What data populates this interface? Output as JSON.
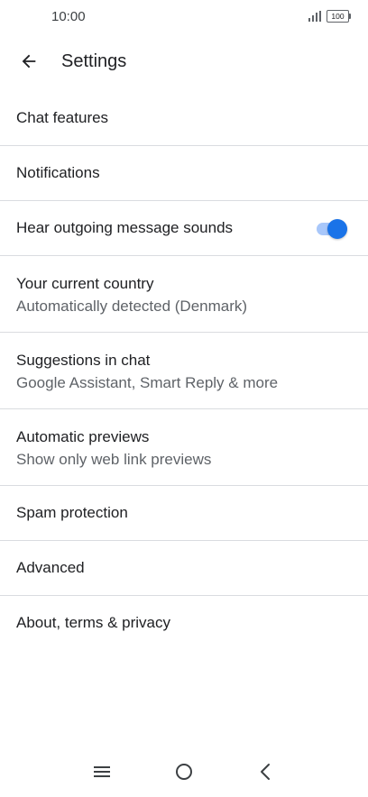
{
  "status_bar": {
    "time": "10:00",
    "battery": "100",
    "icons": [
      "signal-icon",
      "battery-icon"
    ]
  },
  "app_bar": {
    "back_icon": "arrow-left-icon",
    "title": "Settings"
  },
  "settings": {
    "items": [
      {
        "title": "Chat features"
      },
      {
        "title": "Notifications"
      },
      {
        "title": "Hear outgoing message sounds",
        "toggle_on": true
      },
      {
        "title": "Your current country",
        "subtitle": "Automatically detected (Denmark)"
      },
      {
        "title": "Suggestions in chat",
        "subtitle": "Google Assistant, Smart Reply & more"
      },
      {
        "title": "Automatic previews",
        "subtitle": "Show only web link previews"
      },
      {
        "title": "Spam protection"
      },
      {
        "title": "Advanced"
      },
      {
        "title": "About, terms & privacy"
      }
    ]
  },
  "colors": {
    "accent": "#1a73e8",
    "accent_track": "#a8c7fa",
    "divider": "#dadce0",
    "text_primary": "#202124",
    "text_secondary": "#5f6368"
  },
  "nav_bar": {
    "icons": [
      "menu-icon",
      "home-icon",
      "back-icon"
    ]
  }
}
